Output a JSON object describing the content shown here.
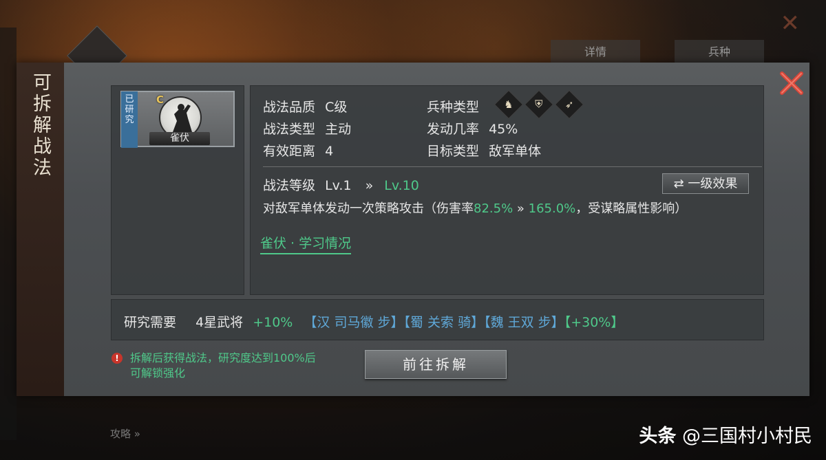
{
  "background": {
    "tabs": [
      "详情",
      "兵种"
    ],
    "bottom_text": "攻略 »"
  },
  "dialog": {
    "side_title": "可拆解战法",
    "card": {
      "researched_tag": "已研究",
      "grade": "C",
      "name": "雀伏"
    },
    "info": {
      "quality_label": "战法品质",
      "quality_value": "C级",
      "troop_label": "兵种类型",
      "troop_icons": [
        "cavalry-icon",
        "shield-icon",
        "bow-icon"
      ],
      "type_label": "战法类型",
      "type_value": "主动",
      "rate_label": "发动几率",
      "rate_value": "45%",
      "range_label": "有效距离",
      "range_value": "4",
      "target_label": "目标类型",
      "target_value": "敌军单体",
      "level_label": "战法等级",
      "level_from": "Lv.1",
      "level_arrow": "»",
      "level_to": "Lv.10",
      "effect_button": "一级效果",
      "desc_prefix": "对敌军单体发动一次策略攻击（伤害率",
      "desc_from": "82.5%",
      "desc_arrow": " » ",
      "desc_to": "165.0%",
      "desc_suffix": "，受谋略属性影响）",
      "learn_link": "雀伏 · 学习情况"
    },
    "requirement": {
      "label": "研究需要",
      "stars": "4星武将",
      "bonus": "+10%",
      "heroes": [
        "【汉 司马徽 步】",
        "【蜀 关索 骑】",
        "【魏 王双 步】"
      ],
      "extra": "【+30%】"
    },
    "warning": {
      "line1": "拆解后获得战法，研究度达到100%后",
      "line2": "可解锁强化"
    },
    "go_button": "前往拆解"
  },
  "watermark": {
    "logo": "头条",
    "handle": "@三国村小村民"
  },
  "colors": {
    "green": "#4fc98a",
    "blue": "#5fa8d8",
    "close_red": "#d9473a"
  }
}
